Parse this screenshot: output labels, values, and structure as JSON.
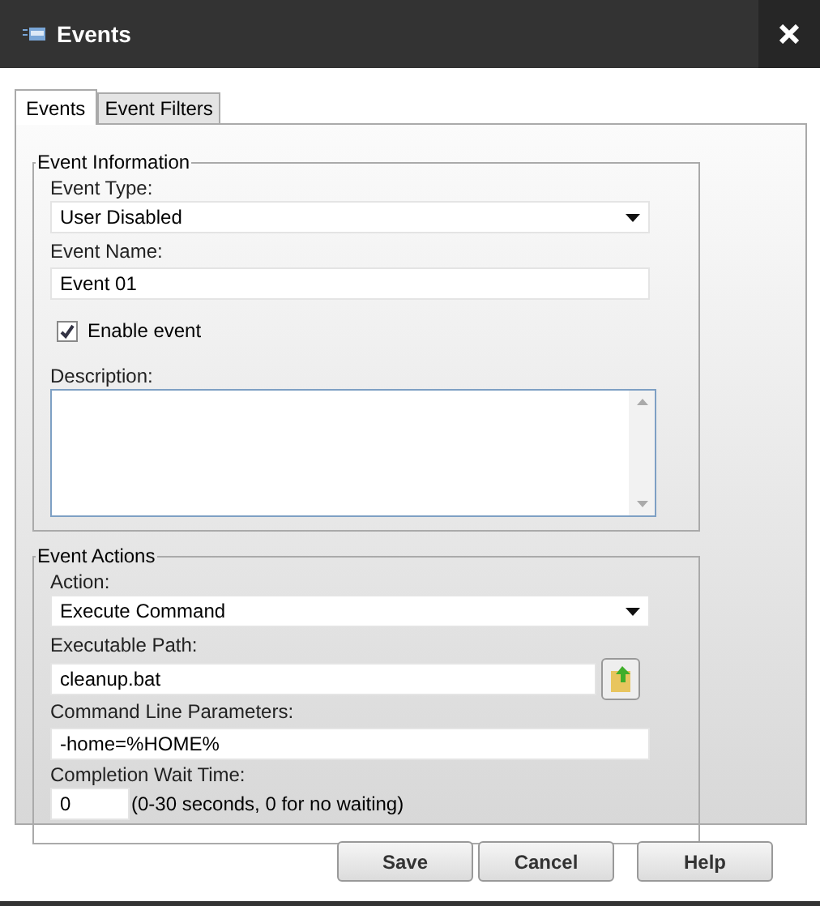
{
  "window": {
    "title": "Events"
  },
  "tabs": [
    {
      "label": "Events",
      "selected": true
    },
    {
      "label": "Event Filters",
      "selected": false
    }
  ],
  "event_information": {
    "legend": "Event Information",
    "event_type": {
      "label": "Event Type:",
      "value": "User Disabled"
    },
    "event_name": {
      "label": "Event Name:",
      "value": "Event 01"
    },
    "enable_event": {
      "label": "Enable event",
      "checked": true
    },
    "description": {
      "label": "Description:"
    }
  },
  "event_actions": {
    "legend": "Event Actions",
    "action": {
      "label": "Action:",
      "value": "Execute Command"
    },
    "executable_path": {
      "label": "Executable Path:",
      "value": "cleanup.bat"
    },
    "command_line_parameters": {
      "label": "Command Line Parameters:",
      "value": "-home=%HOME%"
    },
    "completion_wait_time": {
      "label": "Completion Wait Time:",
      "value": "0",
      "hint": "(0-30 seconds, 0 for no waiting)"
    }
  },
  "buttons": [
    "Save",
    "Cancel",
    "Help"
  ]
}
